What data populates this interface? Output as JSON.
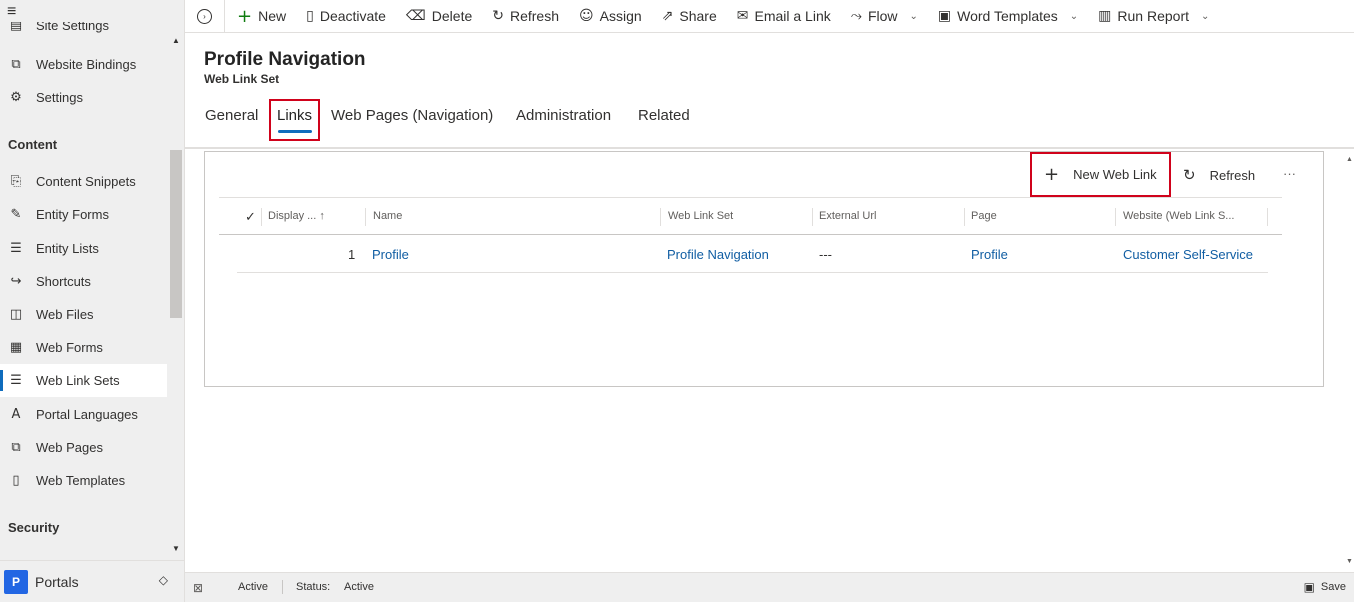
{
  "leftnav": {
    "items_top": [
      {
        "label": "Site Settings",
        "icon": "site-settings-icon"
      },
      {
        "label": "Website Bindings",
        "icon": "binding-icon"
      },
      {
        "label": "Settings",
        "icon": "gear-icon"
      }
    ],
    "section_content": "Content",
    "items_content": [
      {
        "label": "Content Snippets",
        "icon": "snippet-icon"
      },
      {
        "label": "Entity Forms",
        "icon": "form-icon"
      },
      {
        "label": "Entity Lists",
        "icon": "list-icon"
      },
      {
        "label": "Shortcuts",
        "icon": "shortcut-icon"
      },
      {
        "label": "Web Files",
        "icon": "web-file-icon"
      },
      {
        "label": "Web Forms",
        "icon": "web-form-icon"
      },
      {
        "label": "Web Link Sets",
        "icon": "link-set-icon"
      },
      {
        "label": "Portal Languages",
        "icon": "language-icon"
      },
      {
        "label": "Web Pages",
        "icon": "web-page-icon"
      },
      {
        "label": "Web Templates",
        "icon": "template-icon"
      }
    ],
    "section_security": "Security",
    "area": {
      "badge": "P",
      "label": "Portals"
    }
  },
  "commandbar": {
    "items": [
      {
        "label": "New",
        "icon": "plus-icon"
      },
      {
        "label": "Deactivate",
        "icon": "deactivate-icon"
      },
      {
        "label": "Delete",
        "icon": "trash-icon"
      },
      {
        "label": "Refresh",
        "icon": "refresh-icon"
      },
      {
        "label": "Assign",
        "icon": "assign-icon"
      },
      {
        "label": "Share",
        "icon": "share-icon"
      },
      {
        "label": "Email a Link",
        "icon": "email-icon"
      },
      {
        "label": "Flow",
        "icon": "flow-icon"
      },
      {
        "label": "Word Templates",
        "icon": "word-template-icon"
      },
      {
        "label": "Run Report",
        "icon": "report-icon"
      }
    ]
  },
  "header": {
    "title": "Profile Navigation",
    "subtitle": "Web Link Set"
  },
  "tabs": [
    {
      "label": "General"
    },
    {
      "label": "Links"
    },
    {
      "label": "Web Pages (Navigation)"
    },
    {
      "label": "Administration"
    },
    {
      "label": "Related"
    }
  ],
  "subgrid": {
    "new_label": "New Web Link",
    "refresh_label": "Refresh",
    "more_label": "···",
    "columns": [
      "Display ...",
      "Name",
      "Web Link Set",
      "External Url",
      "Page",
      "Website (Web Link S..."
    ],
    "rows": [
      {
        "display_order": "1",
        "name": "Profile",
        "web_link_set": "Profile Navigation",
        "external_url": "---",
        "page": "Profile",
        "website": "Customer Self-Service"
      }
    ]
  },
  "statusbar": {
    "state": "Active",
    "status_label": "Status:",
    "status_value": "Active",
    "save_label": "Save"
  }
}
